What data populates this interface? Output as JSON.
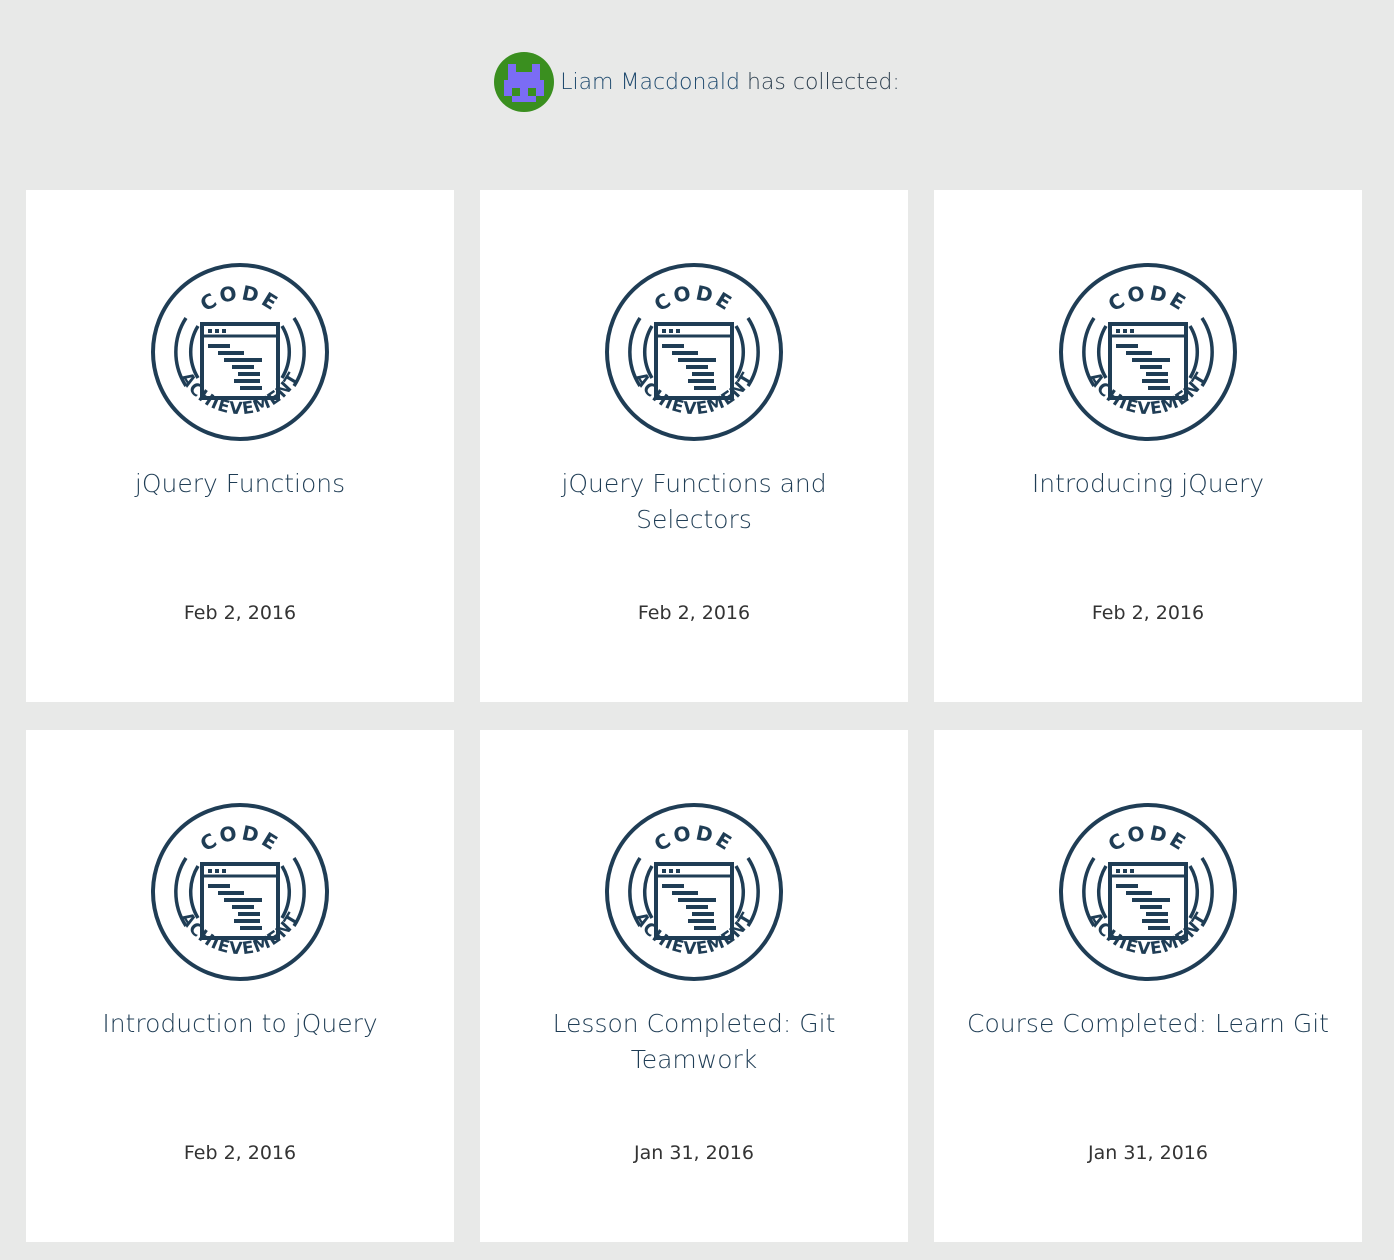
{
  "header": {
    "user_name": "Liam Macdonald",
    "suffix": " has collected:",
    "avatar_icon": "pixel-invader-avatar-icon"
  },
  "colors": {
    "background": "#e8e9e8",
    "card": "#ffffff",
    "badge": "#1f3d55",
    "avatar_bg": "#3a8f1f",
    "avatar_fg": "#7b6cf5"
  },
  "badge": {
    "top_text": "CODE",
    "bottom_text": "ACHIEVEMENT",
    "icon": "code-achievement-badge-icon"
  },
  "achievements": [
    {
      "title": "jQuery Functions",
      "date": "Feb 2, 2016"
    },
    {
      "title": "jQuery Functions and Selectors",
      "date": "Feb 2, 2016"
    },
    {
      "title": "Introducing jQuery",
      "date": "Feb 2, 2016"
    },
    {
      "title": "Introduction to jQuery",
      "date": "Feb 2, 2016"
    },
    {
      "title": "Lesson Completed: Git Teamwork",
      "date": "Jan 31, 2016"
    },
    {
      "title": "Course Completed: Learn Git",
      "date": "Jan 31, 2016"
    }
  ]
}
